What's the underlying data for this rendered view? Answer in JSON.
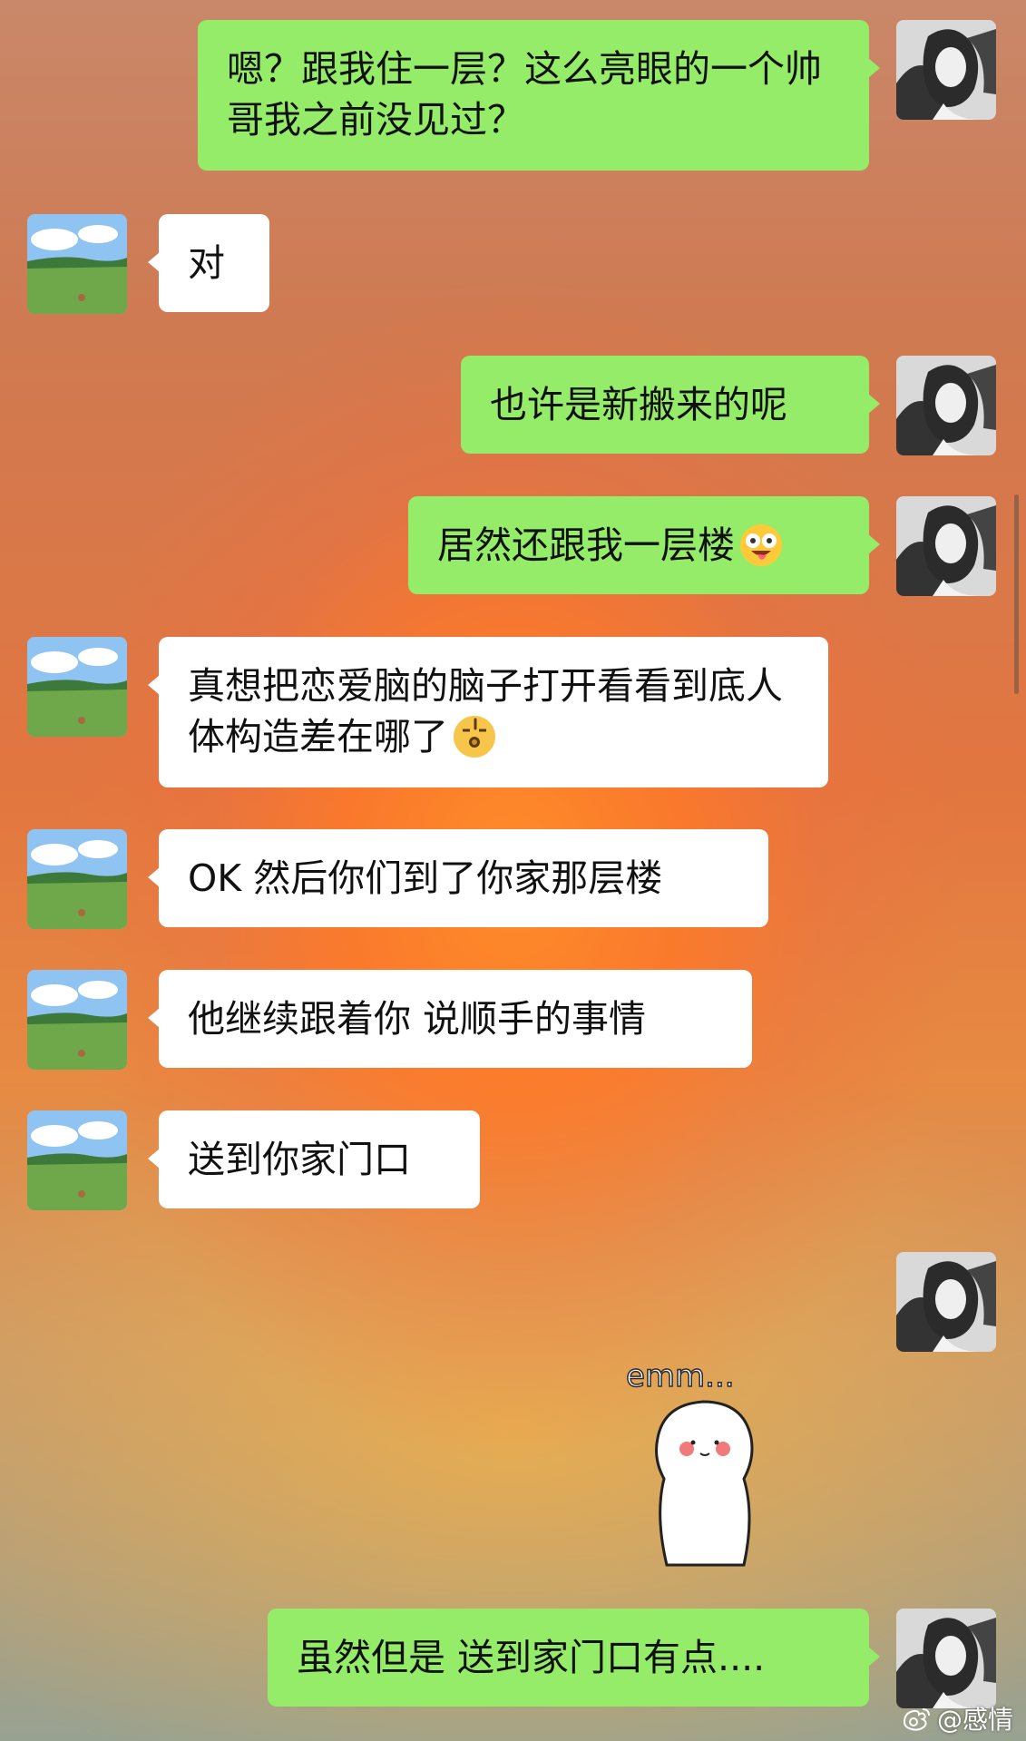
{
  "chat": {
    "messages": [
      {
        "sender": "self",
        "text": "嗯？跟我住一层？这么亮眼的一个帅哥我之前没见过？"
      },
      {
        "sender": "other",
        "text": "对"
      },
      {
        "sender": "self",
        "text": "也许是新搬来的呢"
      },
      {
        "sender": "self",
        "text": "居然还跟我一层楼",
        "emoji": "starstruck-tongue-emoji"
      },
      {
        "sender": "other",
        "text": "真想把恋爱脑的脑子打开看看到底人体构造差在哪了",
        "emoji": "pondering-emoji"
      },
      {
        "sender": "other",
        "text": "OK 然后你们到了你家那层楼"
      },
      {
        "sender": "other",
        "text": "他继续跟着你 说顺手的事情"
      },
      {
        "sender": "other",
        "text": "送到你家门口"
      },
      {
        "sender": "self",
        "sticker": {
          "text": "emm...",
          "icon": "blushing-blob-sticker"
        }
      },
      {
        "sender": "self",
        "text": "虽然但是 送到家门口有点...."
      }
    ]
  },
  "watermark": {
    "icon": "weibo-logo-icon",
    "text": "@感情"
  },
  "colors": {
    "self_bubble": "#95ec69",
    "other_bubble": "#ffffff"
  }
}
